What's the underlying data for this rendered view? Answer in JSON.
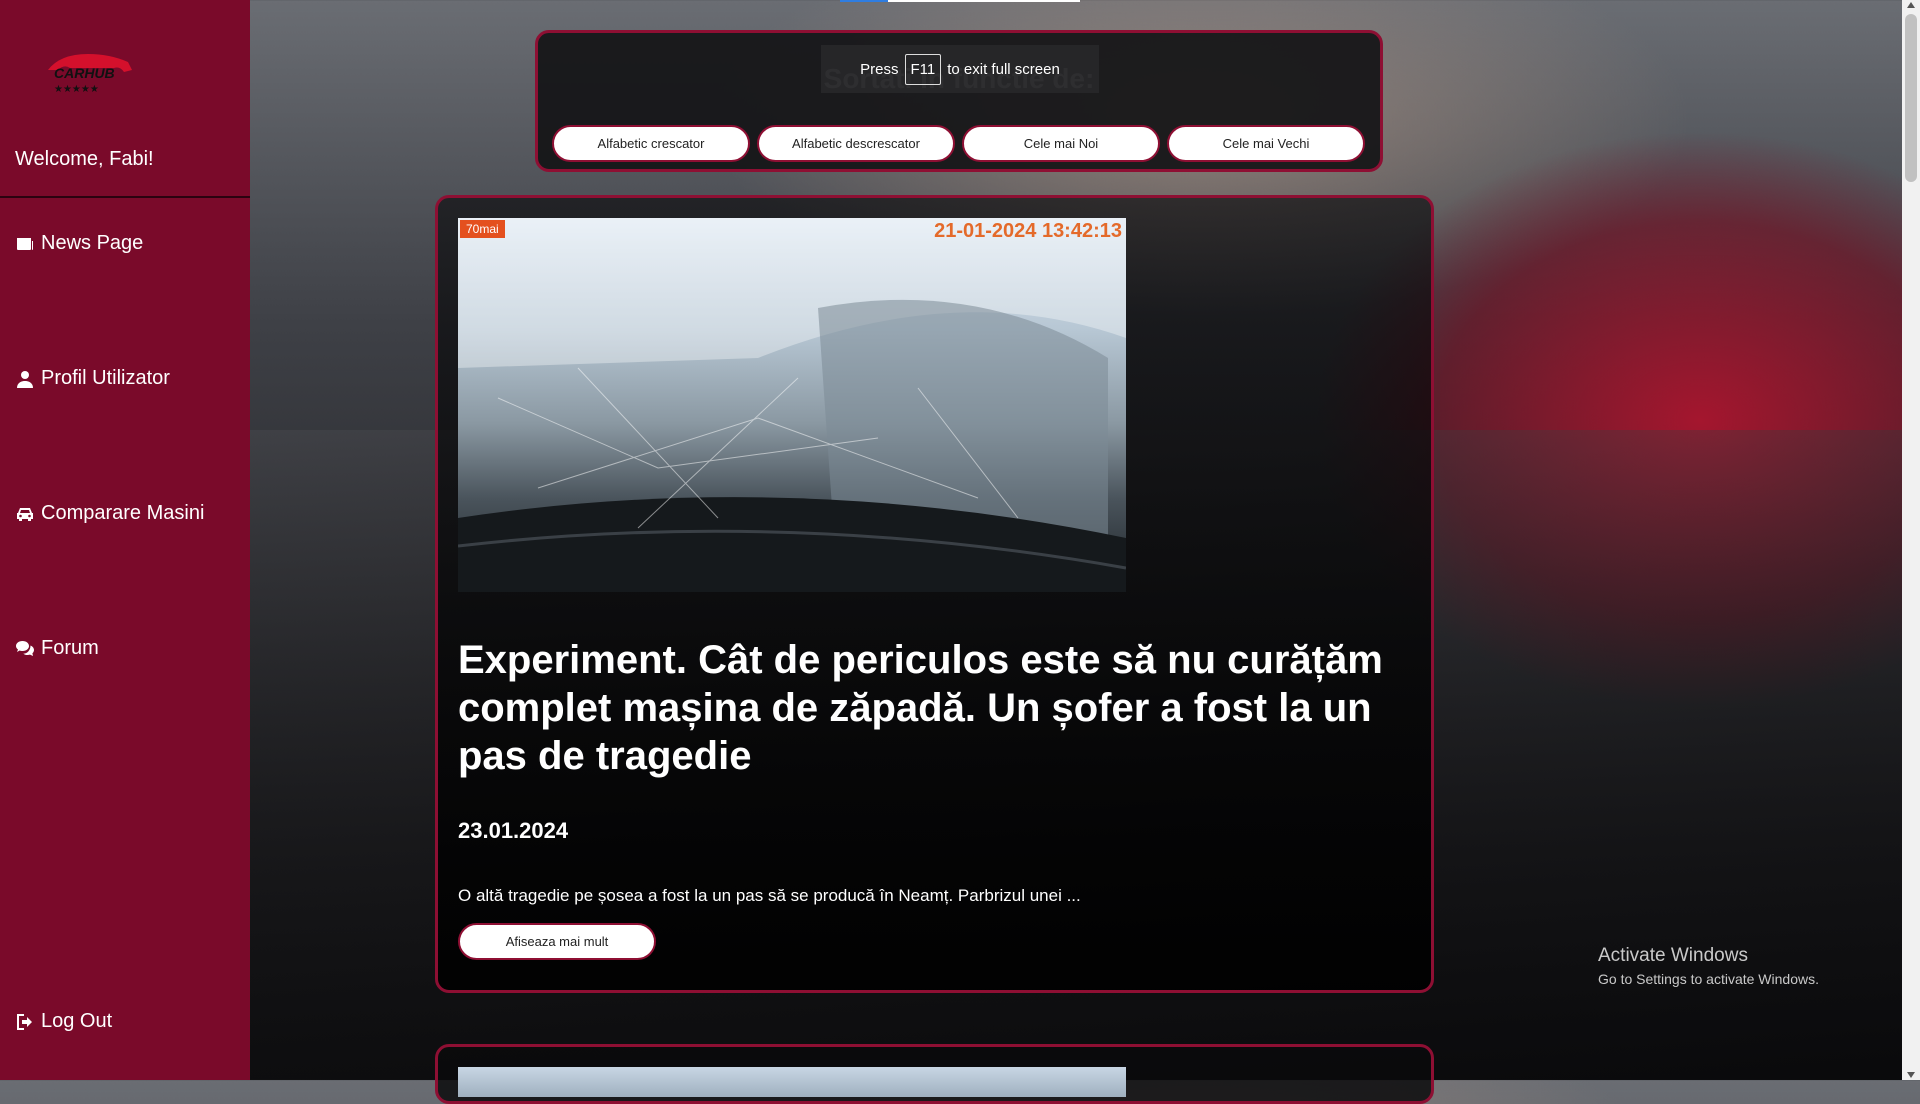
{
  "sidebar": {
    "welcome": "Welcome, Fabi!",
    "items": [
      {
        "label": "News Page",
        "icon": "newspaper-icon"
      },
      {
        "label": "Profil Utilizator",
        "icon": "user-icon"
      },
      {
        "label": "Comparare Masini",
        "icon": "car-icon"
      },
      {
        "label": "Forum",
        "icon": "comments-icon"
      }
    ],
    "logout": {
      "label": "Log Out",
      "icon": "sign-out-icon"
    },
    "logo": {
      "text": "CARHUB",
      "icon": "carhub-logo"
    }
  },
  "sort": {
    "title": "Sortati in functie de:",
    "buttons": [
      "Alfabetic crescator",
      "Alfabetic descrescator",
      "Cele mai Noi",
      "Cele mai Vechi"
    ]
  },
  "fullscreen_toast": {
    "press": "Press",
    "key": "F11",
    "rest": "to exit full screen"
  },
  "article": {
    "camera_badge": "70mai",
    "camera_timestamp": "21-01-2024 13:42:13",
    "title": "Experiment. Cât de periculos este să nu curățăm complet mașina de zăpadă. Un șofer a fost la un pas de tragedie",
    "date": "23.01.2024",
    "excerpt": "O altă tragedie pe șosea a fost la un pas să se producă în Neamț. Parbrizul unei ...",
    "button": "Afiseaza mai mult"
  },
  "windows_watermark": {
    "line1": "Activate Windows",
    "line2": "Go to Settings to activate Windows."
  },
  "colors": {
    "sidebar": "#7a0a2a",
    "accent_border": "#8e0f33",
    "panel": "#141416"
  }
}
